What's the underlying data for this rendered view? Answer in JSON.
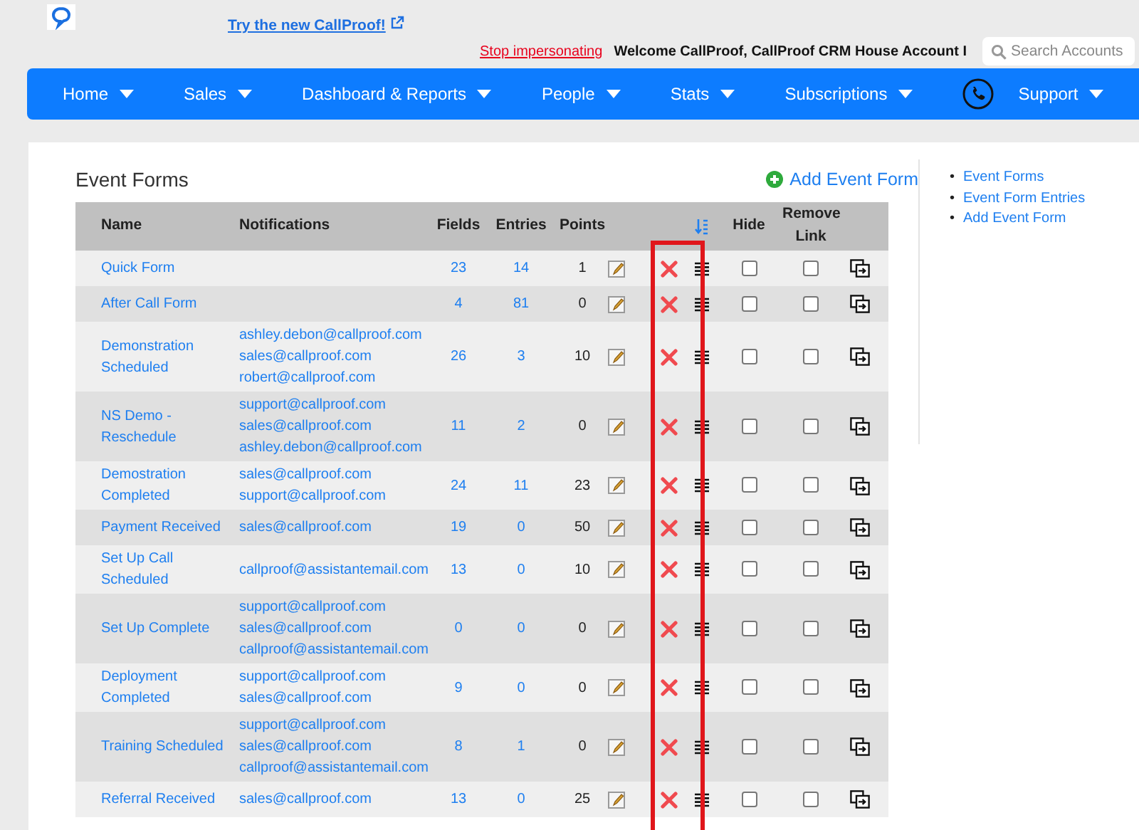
{
  "header": {
    "try_link": "Try the new CallProof!",
    "stop_link": "Stop impersonating",
    "welcome": "Welcome CallProof, CallProof CRM House Account I",
    "search": {
      "placeholder": "Search Accounts"
    }
  },
  "nav": [
    {
      "kind": "menu",
      "label": "Home",
      "dropdown": true
    },
    {
      "kind": "menu",
      "label": "Sales",
      "dropdown": true
    },
    {
      "kind": "menu",
      "label": "Dashboard & Reports",
      "dropdown": true
    },
    {
      "kind": "menu",
      "label": "People",
      "dropdown": true
    },
    {
      "kind": "menu",
      "label": "Stats",
      "dropdown": true
    },
    {
      "kind": "menu",
      "label": "Subscriptions",
      "dropdown": true
    },
    {
      "kind": "phone"
    },
    {
      "kind": "menu",
      "label": "Support",
      "dropdown": true
    }
  ],
  "page": {
    "title": "Event Forms",
    "add_link": "Add Event Form"
  },
  "table": {
    "columns": [
      "Name",
      "Notifications",
      "Fields",
      "Entries",
      "Points",
      "Hide",
      "Remove Link"
    ],
    "delete_column_highlighted": true,
    "rows": [
      {
        "name": "Quick Form",
        "notifications": [],
        "fields": "23",
        "entries": "14",
        "points": "1",
        "hide": false,
        "remove_link": false
      },
      {
        "name": "After Call Form",
        "notifications": [],
        "fields": "4",
        "entries": "81",
        "points": "0",
        "hide": false,
        "remove_link": false
      },
      {
        "name": "Demonstration Scheduled",
        "notifications": [
          "ashley.debon@callproof.com",
          "sales@callproof.com",
          "robert@callproof.com"
        ],
        "fields": "26",
        "entries": "3",
        "points": "10",
        "hide": false,
        "remove_link": false
      },
      {
        "name": "NS Demo - Reschedule",
        "notifications": [
          "support@callproof.com",
          "sales@callproof.com",
          "ashley.debon@callproof.com"
        ],
        "fields": "11",
        "entries": "2",
        "points": "0",
        "hide": false,
        "remove_link": false
      },
      {
        "name": "Demostration Completed",
        "notifications": [
          "sales@callproof.com",
          "support@callproof.com"
        ],
        "fields": "24",
        "entries": "11",
        "points": "23",
        "hide": false,
        "remove_link": false
      },
      {
        "name": "Payment Received",
        "notifications": [
          "sales@callproof.com"
        ],
        "fields": "19",
        "entries": "0",
        "points": "50",
        "hide": false,
        "remove_link": false
      },
      {
        "name": "Set Up Call Scheduled",
        "notifications": [
          "callproof@assistantemail.com"
        ],
        "fields": "13",
        "entries": "0",
        "points": "10",
        "hide": false,
        "remove_link": false
      },
      {
        "name": "Set Up Complete",
        "notifications": [
          "support@callproof.com",
          "sales@callproof.com",
          "callproof@assistantemail.com"
        ],
        "fields": "0",
        "entries": "0",
        "points": "0",
        "hide": false,
        "remove_link": false
      },
      {
        "name": "Deployment Completed",
        "notifications": [
          "support@callproof.com",
          "sales@callproof.com"
        ],
        "fields": "9",
        "entries": "0",
        "points": "0",
        "hide": false,
        "remove_link": false
      },
      {
        "name": "Training Scheduled",
        "notifications": [
          "support@callproof.com",
          "sales@callproof.com",
          "callproof@assistantemail.com"
        ],
        "fields": "8",
        "entries": "1",
        "points": "0",
        "hide": false,
        "remove_link": false
      },
      {
        "name": "Referral Received",
        "notifications": [
          "sales@callproof.com"
        ],
        "fields": "13",
        "entries": "0",
        "points": "25",
        "hide": false,
        "remove_link": false
      }
    ]
  },
  "sidebar": {
    "links": [
      {
        "bullet": "•",
        "label": "Event Forms"
      },
      {
        "bullet": "•",
        "label": "Event Form Entries"
      },
      {
        "bullet": "•",
        "label": "Add Event Form"
      }
    ]
  }
}
